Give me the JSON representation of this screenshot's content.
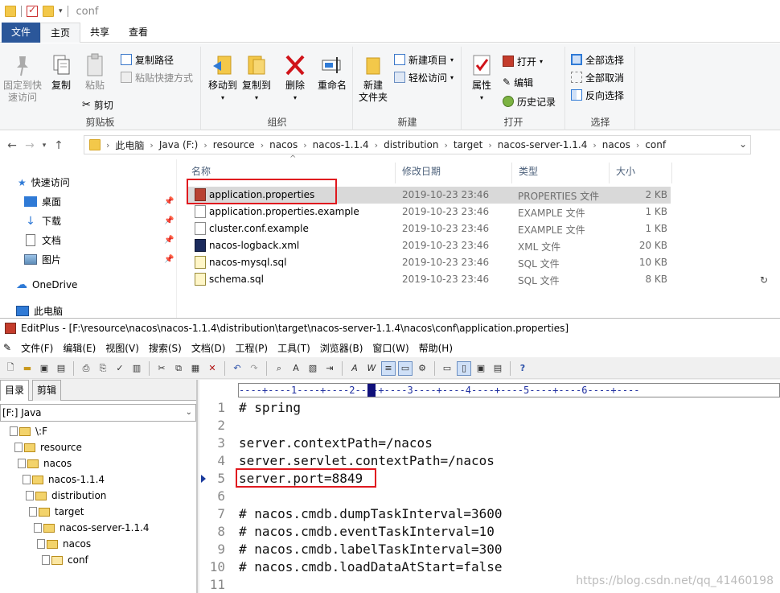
{
  "explorer": {
    "title": "conf",
    "ribbon_tabs": [
      "文件",
      "主页",
      "共享",
      "查看"
    ],
    "clipboard": {
      "pin_label": "固定到快\n速访问",
      "copy_label": "复制",
      "paste_label": "粘贴",
      "copy_path_label": "复制路径",
      "paste_shortcut_label": "粘贴快捷方式",
      "cut_label": "剪切",
      "group_label": "剪贴板"
    },
    "organize": {
      "move_to_label": "移动到",
      "copy_to_label": "复制到",
      "delete_label": "删除",
      "rename_label": "重命名",
      "group_label": "组织"
    },
    "new": {
      "new_folder_label": "新建\n文件夹",
      "new_item_label": "新建项目",
      "easy_access_label": "轻松访问",
      "group_label": "新建"
    },
    "open": {
      "properties_label": "属性",
      "open_label": "打开",
      "edit_label": "编辑",
      "history_label": "历史记录",
      "group_label": "打开"
    },
    "select": {
      "select_all_label": "全部选择",
      "select_none_label": "全部取消",
      "invert_label": "反向选择",
      "group_label": "选择"
    },
    "breadcrumbs": [
      "此电脑",
      "Java (F:)",
      "resource",
      "nacos",
      "nacos-1.1.4",
      "distribution",
      "target",
      "nacos-server-1.1.4",
      "nacos",
      "conf"
    ],
    "nav_pane": {
      "quick_access": "快速访问",
      "items": [
        "桌面",
        "下载",
        "文档",
        "图片"
      ],
      "onedrive": "OneDrive",
      "this_pc": "此电脑"
    },
    "columns": [
      "名称",
      "修改日期",
      "类型",
      "大小"
    ],
    "files": [
      {
        "name": "application.properties",
        "date": "2019-10-23 23:46",
        "type": "PROPERTIES 文件",
        "size": "2 KB"
      },
      {
        "name": "application.properties.example",
        "date": "2019-10-23 23:46",
        "type": "EXAMPLE 文件",
        "size": "1 KB"
      },
      {
        "name": "cluster.conf.example",
        "date": "2019-10-23 23:46",
        "type": "EXAMPLE 文件",
        "size": "1 KB"
      },
      {
        "name": "nacos-logback.xml",
        "date": "2019-10-23 23:46",
        "type": "XML 文件",
        "size": "20 KB"
      },
      {
        "name": "nacos-mysql.sql",
        "date": "2019-10-23 23:46",
        "type": "SQL 文件",
        "size": "10 KB"
      },
      {
        "name": "schema.sql",
        "date": "2019-10-23 23:46",
        "type": "SQL 文件",
        "size": "8 KB"
      }
    ]
  },
  "editplus": {
    "title": "EditPlus - [F:\\resource\\nacos\\nacos-1.1.4\\distribution\\target\\nacos-server-1.1.4\\nacos\\conf\\application.properties]",
    "menus": [
      "文件(F)",
      "编辑(E)",
      "视图(V)",
      "搜索(S)",
      "文档(D)",
      "工程(P)",
      "工具(T)",
      "浏览器(B)",
      "窗口(W)",
      "帮助(H)"
    ],
    "left_tabs": [
      "目录",
      "剪辑"
    ],
    "drive": "[F:] Java",
    "tree": [
      "\\:F",
      "resource",
      "nacos",
      "nacos-1.1.4",
      "distribution",
      "target",
      "nacos-server-1.1.4",
      "nacos",
      "conf"
    ],
    "ruler": "----+----1----+----2----+----3----+----4----+----5----+----6----+----",
    "lines": [
      {
        "n": "1",
        "text": "# spring"
      },
      {
        "n": "2",
        "text": ""
      },
      {
        "n": "3",
        "text": "server.contextPath=/nacos"
      },
      {
        "n": "4",
        "text": "server.servlet.contextPath=/nacos"
      },
      {
        "n": "5",
        "text": "server.port=8849"
      },
      {
        "n": "6",
        "text": ""
      },
      {
        "n": "7",
        "text": "# nacos.cmdb.dumpTaskInterval=3600"
      },
      {
        "n": "8",
        "text": "# nacos.cmdb.eventTaskInterval=10"
      },
      {
        "n": "9",
        "text": "# nacos.cmdb.labelTaskInterval=300"
      },
      {
        "n": "10",
        "text": "# nacos.cmdb.loadDataAtStart=false"
      },
      {
        "n": "11",
        "text": ""
      }
    ]
  },
  "watermark": "https://blog.csdn.net/qq_41460198"
}
